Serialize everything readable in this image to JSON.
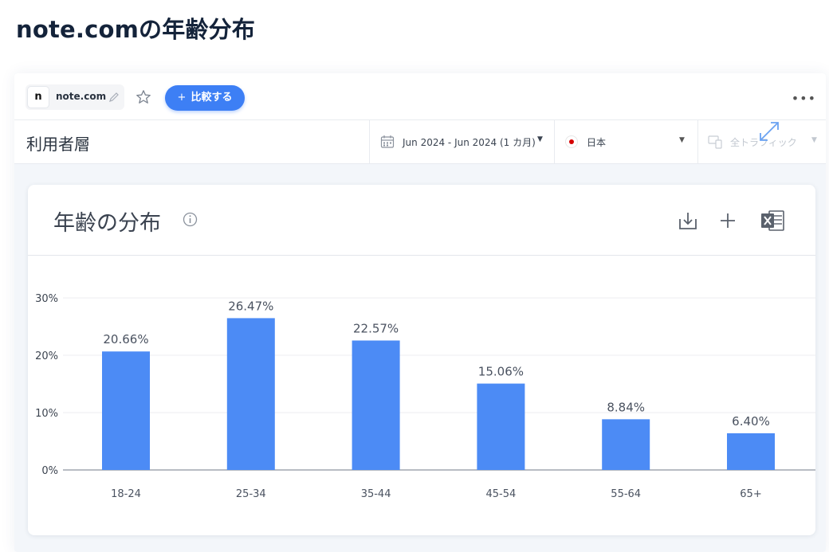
{
  "page_title": "note.comの年齢分布",
  "topbar": {
    "site_favicon": "n",
    "site_name": "note.com",
    "compare_plus": "+",
    "compare_label": "比較する",
    "edit_icon": "pencil-icon",
    "star_icon": "star-icon",
    "more_icon": "more-icon"
  },
  "filterbar": {
    "section_title": "利用者層",
    "date_range": "Jun 2024 - Jun 2024 (1 カ月)",
    "country": "日本",
    "traffic": "全トラフィック"
  },
  "card": {
    "title": "年齢の分布",
    "icons": [
      "info-icon",
      "download-icon",
      "add-icon",
      "excel-icon"
    ]
  },
  "colors": {
    "bar": "#4c8bf5",
    "accent": "#3d7ff5"
  },
  "chart_data": {
    "type": "bar",
    "categories": [
      "18-24",
      "25-34",
      "35-44",
      "45-54",
      "55-64",
      "65+"
    ],
    "values": [
      20.66,
      26.47,
      22.57,
      15.06,
      8.84,
      6.4
    ],
    "value_labels": [
      "20.66%",
      "26.47%",
      "22.57%",
      "15.06%",
      "8.84%",
      "6.40%"
    ],
    "yticks": [
      0,
      10,
      20,
      30
    ],
    "ytick_labels": [
      "0%",
      "10%",
      "20%",
      "30%"
    ],
    "ylim": [
      0,
      30
    ],
    "grid": true
  }
}
